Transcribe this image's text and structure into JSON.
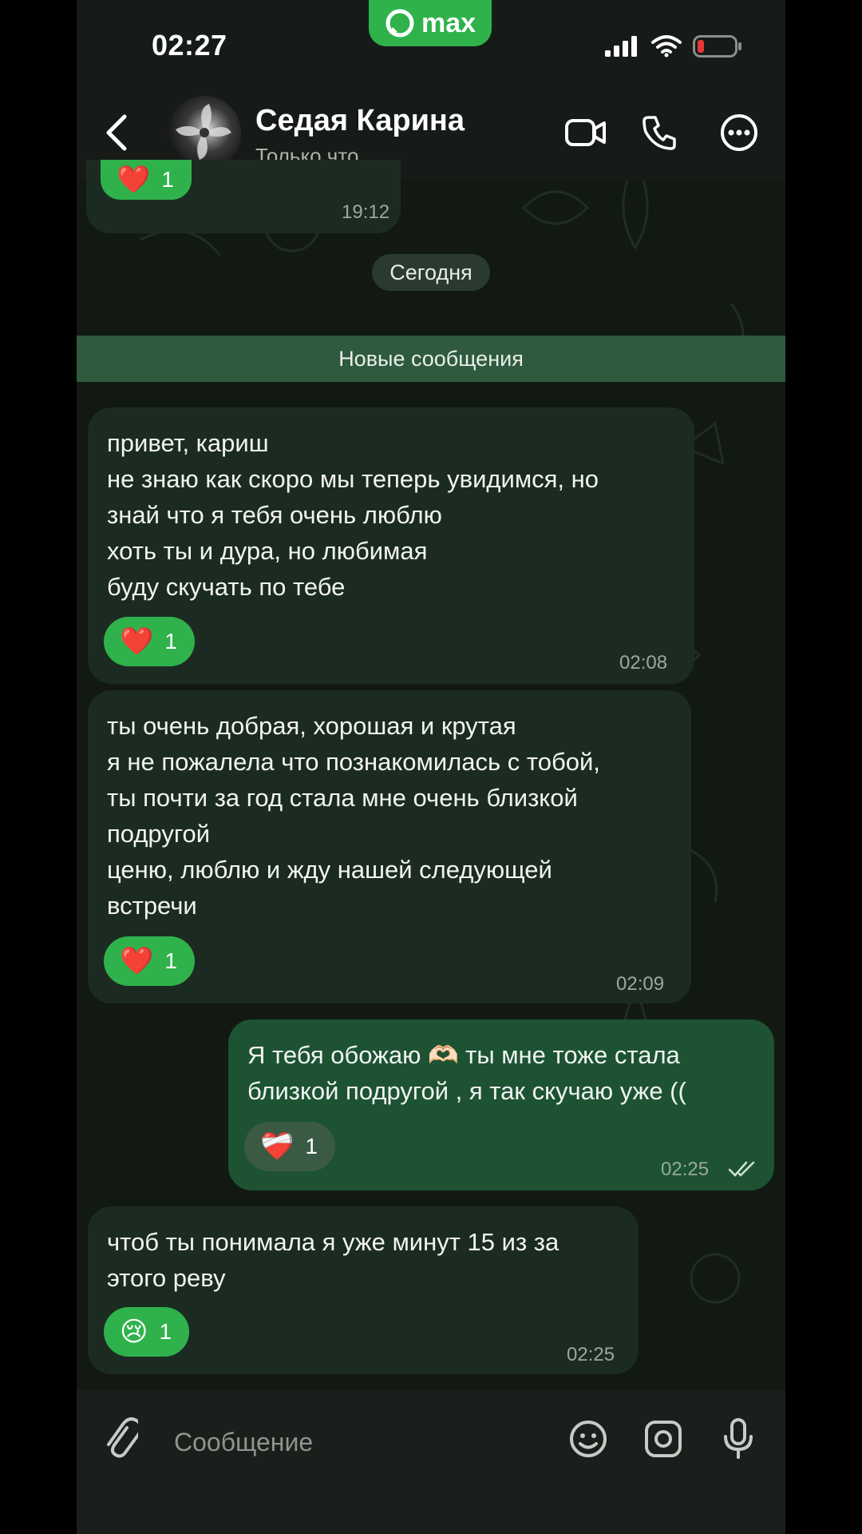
{
  "status_bar": {
    "time": "02:27",
    "app_badge": "max"
  },
  "header": {
    "contact_name": "Седая Карина",
    "contact_status": "Только что"
  },
  "chat": {
    "prev_message": {
      "reaction_emoji": "❤️",
      "reaction_count": "1",
      "time": "19:12"
    },
    "date_divider": "Сегодня",
    "new_messages_label": "Новые сообщения",
    "messages": [
      {
        "direction": "incoming",
        "text": "привет, кариш\nне знаю как скоро мы теперь увидимся, но\nзнай что я тебя очень люблю\nхоть ты и дура, но любимая\nбуду скучать по тебе",
        "reaction_emoji": "❤️",
        "reaction_count": "1",
        "time": "02:08"
      },
      {
        "direction": "incoming",
        "text": "ты очень добрая, хорошая и крутая\nя не пожалела что познакомилась с тобой,\nты почти за год стала мне очень близкой\nподругой\nценю, люблю и жду нашей следующей\nвстречи",
        "reaction_emoji": "❤️",
        "reaction_count": "1",
        "time": "02:09"
      },
      {
        "direction": "outgoing",
        "text": "Я тебя обожаю 🫶🏻 ты мне тоже стала\nблизкой подругой , я так скучаю уже ((",
        "reaction_emoji": "❤️‍🩹",
        "reaction_count": "1",
        "time": "02:25",
        "read": true
      },
      {
        "direction": "incoming",
        "text": "чтоб ты понимала я уже минут 15 из за\nэтого реву",
        "reaction_emoji": "😢",
        "reaction_count": "1",
        "time": "02:25"
      }
    ]
  },
  "composer": {
    "placeholder": "Сообщение"
  },
  "colors": {
    "accent": "#2fb24c",
    "incoming_bubble": "#1c2b21",
    "outgoing_bubble": "#1d5333",
    "background": "#121913"
  }
}
